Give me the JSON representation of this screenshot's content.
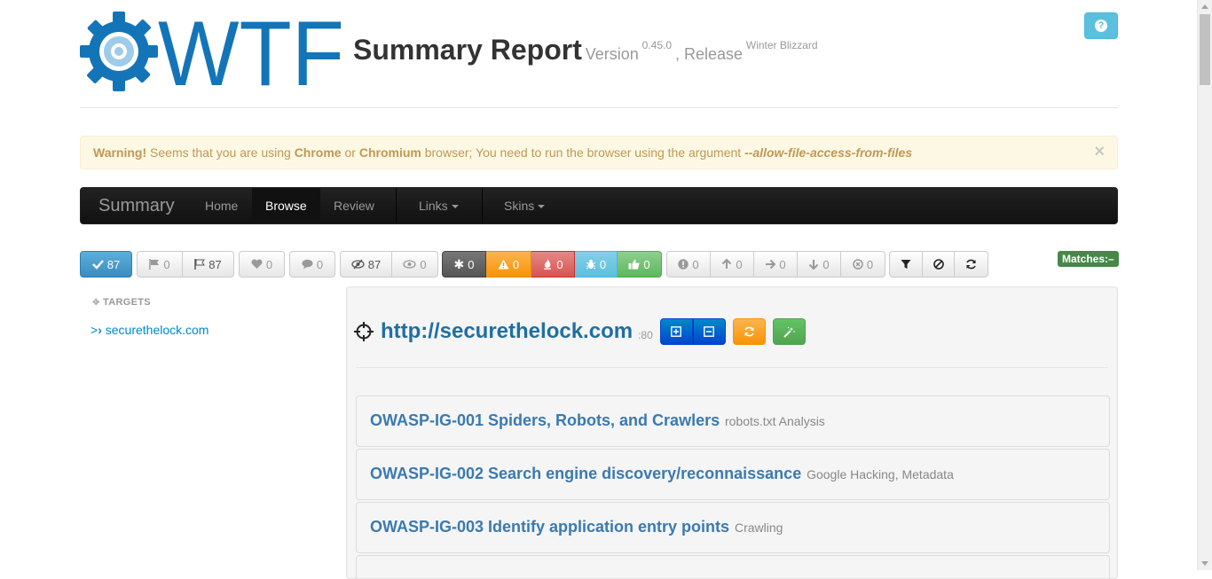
{
  "header": {
    "logo_text": "WTF",
    "title": "Summary Report",
    "version_label": "Version",
    "version": "0.45.0",
    "release_label": ", Release",
    "release": "Winter Blizzard",
    "help_icon": "question-icon"
  },
  "alert": {
    "strong": "Warning!",
    "t1": " Seems that you are using ",
    "chrome": "Chrome",
    "t2": " or ",
    "chromium": "Chromium",
    "t3": " browser; You need to run the browser using the argument ",
    "arg": "--allow-file-access-from-files",
    "close": "×"
  },
  "nav": {
    "brand": "Summary",
    "home": "Home",
    "browse": "Browse",
    "review": "Review",
    "links": "Links",
    "skins": "Skins",
    "active": "Browse"
  },
  "toolbar": {
    "selected_count": "87",
    "flag_count": "0",
    "flag_outline_count": "87",
    "heart_count": "0",
    "comment_count": "0",
    "unseen_count": "87",
    "seen_count": "0",
    "rank_unranked": "0",
    "rank_info": "0",
    "rank_low": "0",
    "rank_medium": "0",
    "rank_high": "0",
    "rank_critical": "0",
    "sort_info": "0",
    "sort_up": "0",
    "sort_right": "0",
    "sort_down": "0",
    "sort_cancel": "0",
    "matches": "Matches:–",
    "colors": {
      "primary": "#4a9cc9",
      "unranked": "#666666",
      "info": "#f0ad4e",
      "low": "#d9534f",
      "medium": "#5bc0de",
      "high": "#5cb85c"
    }
  },
  "sidebar": {
    "heading": "TARGETS",
    "targets": [
      {
        "label": "securethelock.com"
      }
    ]
  },
  "target": {
    "url": "http://securethelock.com",
    "port": ":80"
  },
  "tests": [
    {
      "code": "OWASP-IG-001 Spiders, Robots, and Crawlers",
      "desc": "robots.txt Analysis"
    },
    {
      "code": "OWASP-IG-002 Search engine discovery/reconnaissance",
      "desc": "Google Hacking, Metadata"
    },
    {
      "code": "OWASP-IG-003 Identify application entry points",
      "desc": "Crawling"
    }
  ]
}
